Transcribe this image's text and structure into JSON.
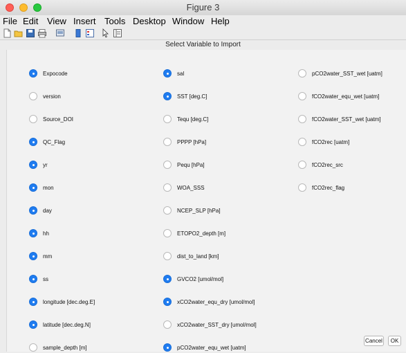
{
  "window": {
    "title": "Figure 3"
  },
  "menu": [
    "File",
    "Edit",
    "View",
    "Insert",
    "Tools",
    "Desktop",
    "Window",
    "Help"
  ],
  "toolbar_icons": [
    "new-figure-icon",
    "open-file-icon",
    "save-icon",
    "print-icon",
    "print-preview-icon",
    "colorbar-icon",
    "legend-icon",
    "pointer-icon",
    "property-inspector-icon"
  ],
  "dialog": {
    "title": "Select Variable to Import"
  },
  "columns": [
    [
      {
        "label": "Expocode",
        "checked": true
      },
      {
        "label": "version",
        "checked": false
      },
      {
        "label": "Source_DOI",
        "checked": false
      },
      {
        "label": "QC_Flag",
        "checked": true
      },
      {
        "label": "yr",
        "checked": true
      },
      {
        "label": "mon",
        "checked": true
      },
      {
        "label": "day",
        "checked": true
      },
      {
        "label": "hh",
        "checked": true
      },
      {
        "label": "mm",
        "checked": true
      },
      {
        "label": "ss",
        "checked": true
      },
      {
        "label": "longitude [dec.deg.E]",
        "checked": true
      },
      {
        "label": "latitude [dec.deg.N]",
        "checked": true
      },
      {
        "label": "sample_depth [m]",
        "checked": false
      }
    ],
    [
      {
        "label": "sal",
        "checked": true
      },
      {
        "label": "SST [deg.C]",
        "checked": true
      },
      {
        "label": "Tequ [deg.C]",
        "checked": false
      },
      {
        "label": "PPPP [hPa]",
        "checked": false
      },
      {
        "label": "Pequ [hPa]",
        "checked": false
      },
      {
        "label": "WOA_SSS",
        "checked": false
      },
      {
        "label": "NCEP_SLP [hPa]",
        "checked": false
      },
      {
        "label": "ETOPO2_depth [m]",
        "checked": false
      },
      {
        "label": "dist_to_land [km]",
        "checked": false
      },
      {
        "label": "GVCO2 [umol/mol]",
        "checked": true
      },
      {
        "label": "xCO2water_equ_dry [umol/mol]",
        "checked": true
      },
      {
        "label": "xCO2water_SST_dry [umol/mol]",
        "checked": false
      },
      {
        "label": "pCO2water_equ_wet [uatm]",
        "checked": true
      }
    ],
    [
      {
        "label": "pCO2water_SST_wet [uatm]",
        "checked": false
      },
      {
        "label": "fCO2water_equ_wet [uatm]",
        "checked": false
      },
      {
        "label": "fCO2water_SST_wet [uatm]",
        "checked": false
      },
      {
        "label": "fCO2rec [uatm]",
        "checked": false
      },
      {
        "label": "fCO2rec_src",
        "checked": false
      },
      {
        "label": "fCO2rec_flag",
        "checked": false
      }
    ]
  ],
  "buttons": {
    "cancel": "Cancel",
    "ok": "OK"
  }
}
